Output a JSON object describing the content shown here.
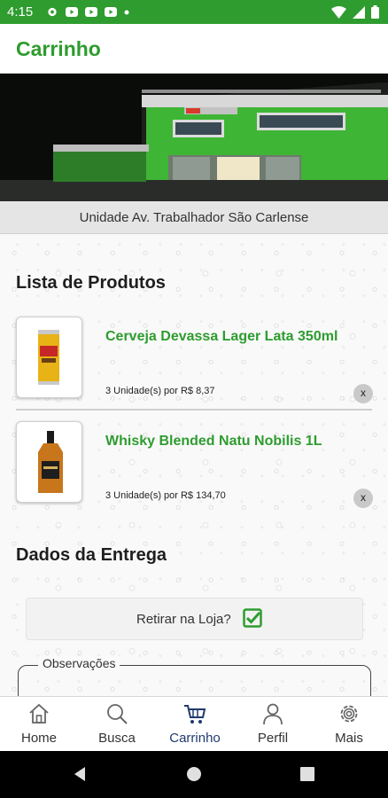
{
  "status_bar": {
    "time": "4:15",
    "left_icons": [
      "gear-icon",
      "youtube-icon",
      "youtube-icon",
      "youtube-icon",
      "dot-icon"
    ],
    "right_icons": [
      "wifi-icon",
      "signal-icon",
      "battery-icon"
    ]
  },
  "header": {
    "title": "Carrinho"
  },
  "store": {
    "name": "Unidade Av. Trabalhador São Carlense"
  },
  "products_section": {
    "title": "Lista de Produtos",
    "items": [
      {
        "name": "Cerveja Devassa Lager Lata 350ml",
        "quantity": "3 Unidade(s) por R$ 8,37",
        "remove": "x",
        "icon": "beer-can-icon"
      },
      {
        "name": "Whisky Blended Natu Nobilis 1L",
        "quantity": "3 Unidade(s) por R$ 134,70",
        "remove": "x",
        "icon": "whisky-bottle-icon"
      }
    ]
  },
  "delivery": {
    "title": "Dados da Entrega",
    "pickup_label": "Retirar na Loja?",
    "pickup_checked": true,
    "notes_label": "Observações",
    "notes_value": ""
  },
  "bottom_nav": {
    "active": "Carrinho",
    "items": [
      {
        "label": "Home",
        "icon": "home-icon"
      },
      {
        "label": "Busca",
        "icon": "search-icon"
      },
      {
        "label": "Carrinho",
        "icon": "cart-icon"
      },
      {
        "label": "Perfil",
        "icon": "user-icon"
      },
      {
        "label": "Mais",
        "icon": "gear-icon"
      }
    ]
  },
  "colors": {
    "primary": "#2e9c2f",
    "active_nav": "#1f3a6e",
    "text": "#333333"
  }
}
